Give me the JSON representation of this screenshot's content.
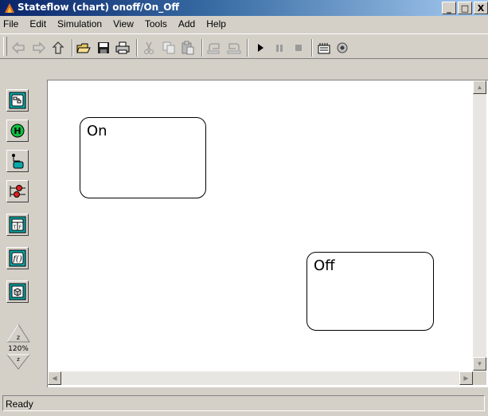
{
  "window": {
    "title": "Stateflow (chart) onoff/On_Off",
    "buttons": [
      "_",
      "□",
      "X"
    ]
  },
  "menu": [
    "File",
    "Edit",
    "Simulation",
    "View",
    "Tools",
    "Add",
    "Help"
  ],
  "toolbar": {
    "icons": [
      "back-arrow-icon",
      "forward-arrow-icon",
      "up-arrow-icon",
      "open-folder-icon",
      "save-icon",
      "print-icon",
      "cut-icon",
      "copy-icon",
      "paste-icon",
      "undo-icon",
      "redo-icon",
      "play-icon",
      "pause-icon",
      "stop-icon",
      "build-icon",
      "target-icon"
    ]
  },
  "palette": {
    "tools": [
      "state-tool-icon",
      "history-junction-icon",
      "default-transition-icon",
      "connective-junction-icon",
      "truth-table-icon",
      "graphical-function-icon",
      "box-icon"
    ],
    "zoom_level": "120%"
  },
  "canvas": {
    "states": [
      {
        "name": "On"
      },
      {
        "name": "Off"
      }
    ]
  },
  "status": {
    "text": "Ready"
  }
}
